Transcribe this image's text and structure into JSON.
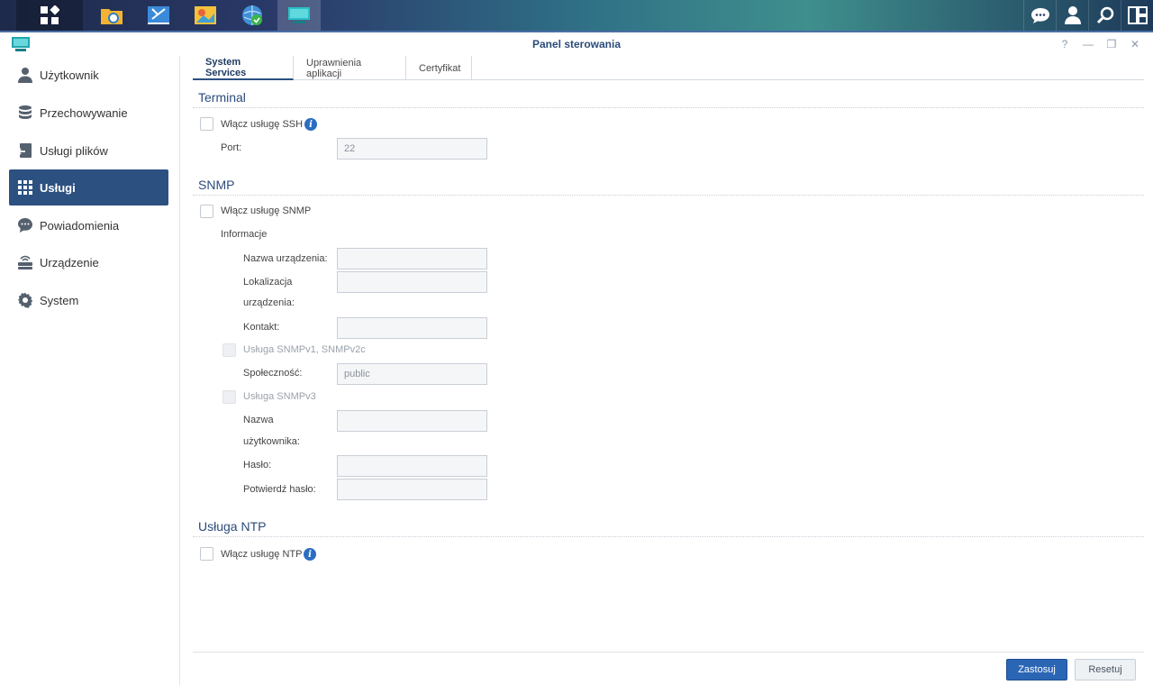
{
  "window": {
    "title": "Panel sterowania"
  },
  "taskbar": {
    "apps": [
      "main-menu-icon",
      "file-station-icon",
      "control-panel-tools-icon",
      "photo-app-icon",
      "web-globe-icon",
      "control-panel-icon"
    ],
    "right_icons": [
      "chat-icon",
      "user-icon",
      "search-icon",
      "widgets-icon"
    ]
  },
  "sidebar": {
    "items": [
      {
        "label": "Użytkownik",
        "icon": "user-icon"
      },
      {
        "label": "Przechowywanie",
        "icon": "database-icon"
      },
      {
        "label": "Usługi plików",
        "icon": "file-services-icon"
      },
      {
        "label": "Usługi",
        "icon": "grid-icon",
        "active": true
      },
      {
        "label": "Powiadomienia",
        "icon": "chat-bubble-icon"
      },
      {
        "label": "Urządzenie",
        "icon": "router-icon"
      },
      {
        "label": "System",
        "icon": "gear-icon"
      }
    ]
  },
  "tabs": [
    "System Services",
    "Uprawnienia aplikacji",
    "Certyfikat"
  ],
  "terminal": {
    "title": "Terminal",
    "ssh_label": "Włącz usługę SSH",
    "port_label": "Port:",
    "port_value": "22"
  },
  "snmp": {
    "title": "SNMP",
    "enable_label": "Włącz usługę SNMP",
    "info_label": "Informacje",
    "device_name_label": "Nazwa urządzenia:",
    "location_label_1": "Lokalizacja",
    "location_label_2": "urządzenia:",
    "contact_label": "Kontakt:",
    "v1v2_label": "Usługa SNMPv1, SNMPv2c",
    "community_label": "Społeczność:",
    "community_value": "public",
    "v3_label": "Usługa SNMPv3",
    "username_label_1": "Nazwa",
    "username_label_2": "użytkownika:",
    "password_label": "Hasło:",
    "confirm_password_label": "Potwierdź hasło:"
  },
  "ntp": {
    "title": "Usługa NTP",
    "enable_label": "Włącz usługę NTP"
  },
  "buttons": {
    "apply": "Zastosuj",
    "reset": "Resetuj"
  },
  "colors": {
    "accent": "#2c5181",
    "apply_button": "#2b66b5",
    "section_title": "#2b4b7a"
  }
}
